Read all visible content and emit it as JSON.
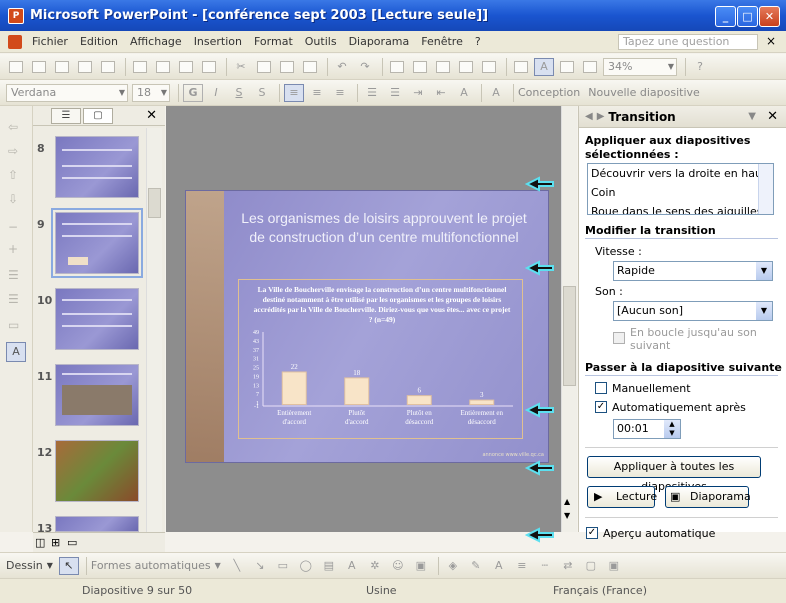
{
  "app": {
    "title": "Microsoft PowerPoint - [conférence sept 2003 [Lecture seule]]"
  },
  "menu": {
    "items": [
      "Fichier",
      "Edition",
      "Affichage",
      "Insertion",
      "Format",
      "Outils",
      "Diaporama",
      "Fenêtre",
      "?"
    ],
    "ask_placeholder": "Tapez une question",
    "close": "×"
  },
  "toolbar": {
    "zoom": "34%",
    "font": "Verdana",
    "size": "18",
    "bold": "G",
    "italic": "I",
    "underline": "S",
    "shadow": "S",
    "design_label": "Conception",
    "new_slide_label": "Nouvelle diapositive"
  },
  "thumbnails": [
    {
      "num": "8"
    },
    {
      "num": "9",
      "selected": true
    },
    {
      "num": "10"
    },
    {
      "num": "11"
    },
    {
      "num": "12"
    },
    {
      "num": "13"
    }
  ],
  "slide": {
    "title": "Les organismes de loisirs approuvent le projet de construction d’un centre multifonctionnel",
    "footnote": "annonce www.ville.qc.ca"
  },
  "chart_data": {
    "type": "bar",
    "title": "La Ville de Boucherville envisage la construction d’un centre multifonctionnel destiné notamment à être utilisé par les organismes et les groupes de loisirs accrédités par la Ville de Boucherville. Diriez-vous que vous êtes... avec ce projet ? (n=49)",
    "categories": [
      "Entièrement d'accord",
      "Plutôt d'accord",
      "Plutôt en désaccord",
      "Entièrement en désaccord"
    ],
    "values": [
      22,
      18,
      6,
      3
    ],
    "yticks": [
      "49",
      "43",
      "37",
      "31",
      "25",
      "19",
      "13",
      "7",
      "1",
      "-1"
    ],
    "ylim": [
      -1,
      49
    ]
  },
  "taskpane": {
    "title": "Transition",
    "apply_label": "Appliquer aux diapositives sélectionnées :",
    "effects": [
      "Découvrir vers la droite en haut",
      "Coin",
      "Roue dans le sens des aiguilles..."
    ],
    "modify_label": "Modifier la transition",
    "speed_label": "Vitesse :",
    "speed_value": "Rapide",
    "sound_label": "Son :",
    "sound_value": "[Aucun son]",
    "loop_label": "En boucle jusqu'au son suivant",
    "advance_label": "Passer à la diapositive suivante",
    "manual_label": "Manuellement",
    "auto_label": "Automatiquement après",
    "auto_time": "00:01",
    "apply_all_button": "Appliquer à toutes les diapositives",
    "play_button": "Lecture",
    "slideshow_button": "Diaporama",
    "autopreview_label": "Aperçu automatique"
  },
  "drawbar": {
    "draw_label": "Dessin",
    "autoshapes_label": "Formes automatiques"
  },
  "status": {
    "slide": "Diapositive 9 sur 50",
    "design": "Usine",
    "language": "Français (France)"
  },
  "colors": {
    "title_blue": "#1a55d0",
    "slide_bg": "#9a98d4",
    "bar_fill": "#f8e4c8"
  }
}
